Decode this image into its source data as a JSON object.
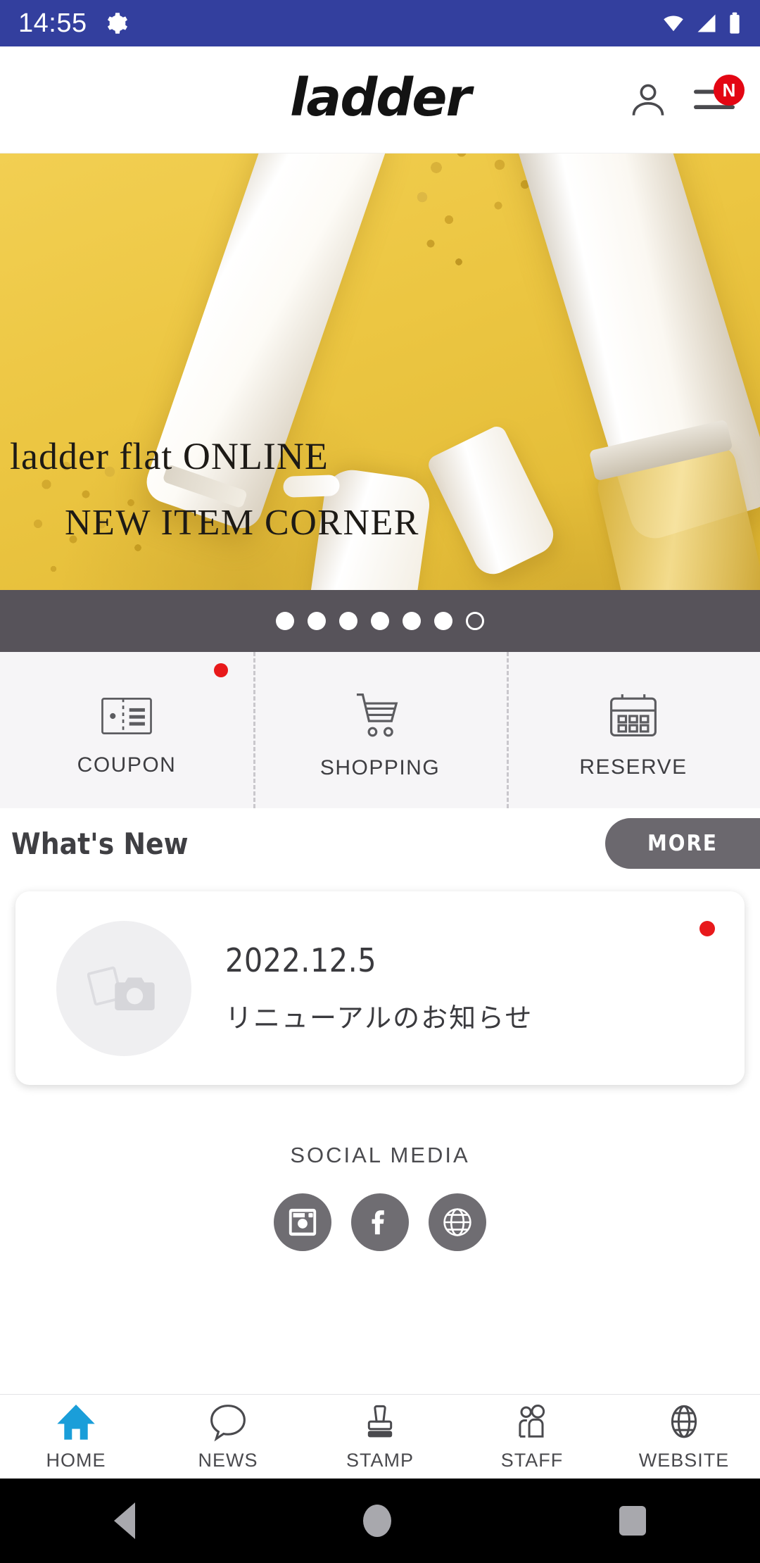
{
  "statusbar": {
    "time": "14:55",
    "icons": [
      "gear-icon",
      "wifi-icon",
      "signal-icon",
      "battery-icon"
    ],
    "background": "#333f9e"
  },
  "header": {
    "logo": "ladder",
    "account_icon": "person-icon",
    "menu_icon": "hamburger-menu-icon",
    "menu_badge": "N",
    "badge_color": "#e30613"
  },
  "hero": {
    "line1": "ladder flat ONLINE",
    "line2": "NEW ITEM CORNER",
    "background_color": "#ecc642",
    "carousel": {
      "total": 7,
      "filled": 6,
      "bar_color": "#57535a"
    }
  },
  "quick_actions": [
    {
      "label": "COUPON",
      "icon": "coupon-ticket-icon",
      "badge": true
    },
    {
      "label": "SHOPPING",
      "icon": "shopping-cart-icon",
      "badge": false
    },
    {
      "label": "RESERVE",
      "icon": "calendar-icon",
      "badge": false
    }
  ],
  "whats_new": {
    "title": "What's New",
    "more_label": "MORE",
    "more_color": "#6b686e",
    "items": [
      {
        "date": "2022.12.5",
        "title": "リニューアルのお知らせ",
        "thumb_icon": "photo-placeholder-icon",
        "badge": true
      }
    ]
  },
  "social": {
    "title": "SOCIAL MEDIA",
    "links": [
      {
        "name": "instagram",
        "icon": "instagram-icon"
      },
      {
        "name": "facebook",
        "icon": "facebook-icon"
      },
      {
        "name": "website",
        "icon": "globe-icon"
      }
    ],
    "circle_color": "#6f6d72"
  },
  "bottom_nav": {
    "active": "HOME",
    "active_color": "#1a9ed9",
    "items": [
      {
        "label": "HOME",
        "icon": "home-icon"
      },
      {
        "label": "NEWS",
        "icon": "speech-bubble-icon"
      },
      {
        "label": "STAMP",
        "icon": "stamp-icon"
      },
      {
        "label": "STAFF",
        "icon": "people-icon"
      },
      {
        "label": "WEBSITE",
        "icon": "globe-icon"
      }
    ]
  },
  "android_nav": {
    "back": "back-triangle-icon",
    "home": "home-circle-icon",
    "recents": "recents-square-icon"
  }
}
